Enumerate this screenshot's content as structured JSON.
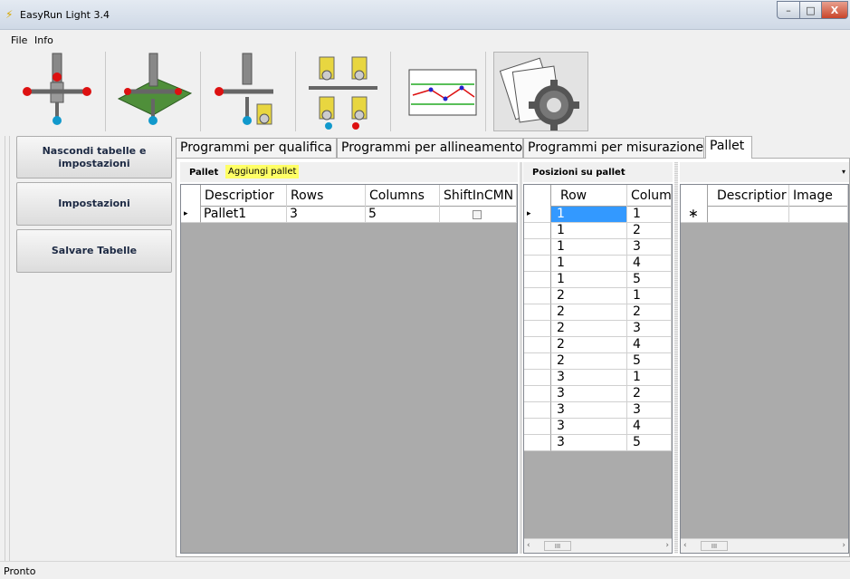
{
  "window": {
    "title": "EasyRun Light 3.4",
    "min": "–",
    "max": "□",
    "close": "X"
  },
  "menu": {
    "file": "File",
    "info": "Info"
  },
  "toolbar": {
    "buttons": [
      "probe-qualify-icon",
      "probe-align-icon",
      "probe-measure-icon",
      "multi-probe-icon",
      "chart-icon",
      "settings-gear-icon"
    ]
  },
  "left": {
    "hide": "Nascondi tabelle e impostazioni",
    "settings": "Impostazioni",
    "save": "Salvare Tabelle"
  },
  "tabs": [
    "Programmi per qualifica",
    "Programmi per allineamento",
    "Programmi per misurazione",
    "Pallet"
  ],
  "pallet": {
    "header": "Pallet",
    "add": "Aggiungi pallet",
    "columns": [
      "Descriptior",
      "Rows",
      "Columns",
      "ShiftInCMN"
    ],
    "row": {
      "desc": "Pallet1",
      "rows": "3",
      "cols": "5"
    }
  },
  "positions": {
    "header": "Posizioni su pallet",
    "columns": [
      "Row",
      "Colum"
    ],
    "rows": [
      [
        "1",
        "1"
      ],
      [
        "1",
        "2"
      ],
      [
        "1",
        "3"
      ],
      [
        "1",
        "4"
      ],
      [
        "1",
        "5"
      ],
      [
        "2",
        "1"
      ],
      [
        "2",
        "2"
      ],
      [
        "2",
        "3"
      ],
      [
        "2",
        "4"
      ],
      [
        "2",
        "5"
      ],
      [
        "3",
        "1"
      ],
      [
        "3",
        "2"
      ],
      [
        "3",
        "3"
      ],
      [
        "3",
        "4"
      ],
      [
        "3",
        "5"
      ]
    ]
  },
  "images": {
    "columns": [
      "Descriptior",
      "Image"
    ],
    "new_row": "∗"
  },
  "scroll": {
    "thumb": "III",
    "left": "‹",
    "right": "›"
  },
  "status": "Pronto",
  "colors": {
    "selection": "#3399ff",
    "highlight": "#ffff66",
    "grid_bg": "#ababab"
  }
}
